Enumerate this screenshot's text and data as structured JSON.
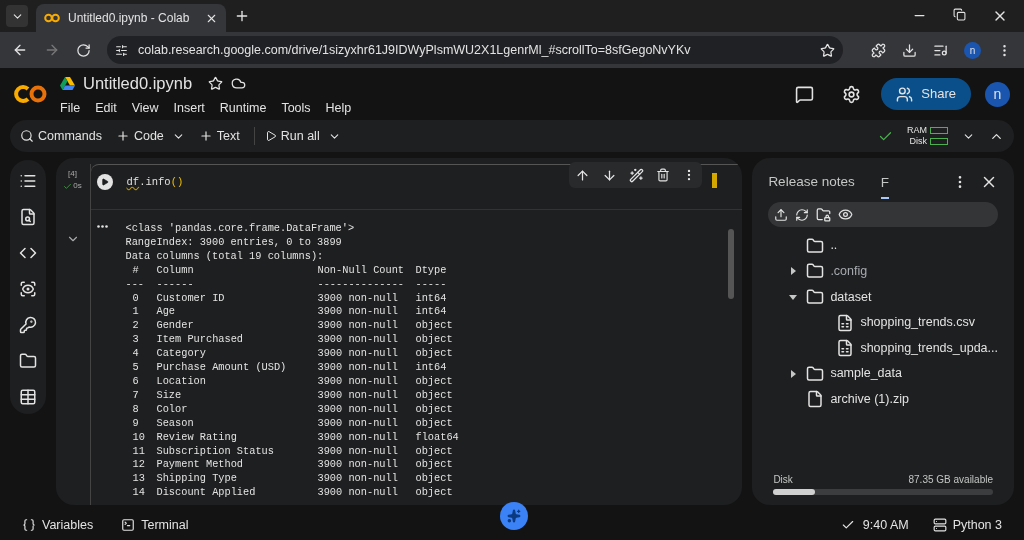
{
  "browser": {
    "tab_title": "Untitled0.ipynb - Colab",
    "url": "colab.research.google.com/drive/1sizyxhr61J9IDWyPlsmWU2X1LgenrMl_#scrollTo=8sfGegoNvYKv",
    "avatar": "n"
  },
  "app": {
    "title": "Untitled0.ipynb",
    "menu": [
      "File",
      "Edit",
      "View",
      "Insert",
      "Runtime",
      "Tools",
      "Help"
    ],
    "share": "Share",
    "avatar": "n"
  },
  "toolbar": {
    "commands": "Commands",
    "code": "Code",
    "text": "Text",
    "run_all": "Run all",
    "ram": "RAM",
    "disk": "Disk"
  },
  "cell": {
    "exec_count": "[4]",
    "time": "0s",
    "code": {
      "object": "df",
      "method": ".info",
      "parens": "()"
    }
  },
  "output": {
    "lines": [
      "<class 'pandas.core.frame.DataFrame'>",
      "RangeIndex: 3900 entries, 0 to 3899",
      "Data columns (total 19 columns):"
    ],
    "table": {
      "columns": [
        "#",
        "Column",
        "Non-Null Count",
        "Dtype"
      ],
      "rules": [
        "---",
        "------",
        "--------------",
        "-----"
      ],
      "rows": [
        [
          "0",
          "Customer ID",
          "3900 non-null",
          "int64"
        ],
        [
          "1",
          "Age",
          "3900 non-null",
          "int64"
        ],
        [
          "2",
          "Gender",
          "3900 non-null",
          "object"
        ],
        [
          "3",
          "Item Purchased",
          "3900 non-null",
          "object"
        ],
        [
          "4",
          "Category",
          "3900 non-null",
          "object"
        ],
        [
          "5",
          "Purchase Amount (USD)",
          "3900 non-null",
          "int64"
        ],
        [
          "6",
          "Location",
          "3900 non-null",
          "object"
        ],
        [
          "7",
          "Size",
          "3900 non-null",
          "object"
        ],
        [
          "8",
          "Color",
          "3900 non-null",
          "object"
        ],
        [
          "9",
          "Season",
          "3900 non-null",
          "object"
        ],
        [
          "10",
          "Review Rating",
          "3900 non-null",
          "float64"
        ],
        [
          "11",
          "Subscription Status",
          "3900 non-null",
          "object"
        ],
        [
          "12",
          "Payment Method",
          "3900 non-null",
          "object"
        ],
        [
          "13",
          "Shipping Type",
          "3900 non-null",
          "object"
        ],
        [
          "14",
          "Discount Applied",
          "3900 non-null",
          "object"
        ]
      ]
    }
  },
  "files_panel": {
    "title": "Release notes",
    "tab": "F",
    "tree": [
      {
        "name": "..",
        "kind": "folder"
      },
      {
        "name": ".config",
        "kind": "folder",
        "expanded": false
      },
      {
        "name": "dataset",
        "kind": "folder",
        "expanded": true,
        "children": [
          {
            "name": "shopping_trends.csv",
            "kind": "csv"
          },
          {
            "name": "shopping_trends_upda...",
            "kind": "csv"
          }
        ]
      },
      {
        "name": "sample_data",
        "kind": "folder",
        "expanded": false
      },
      {
        "name": "archive (1).zip",
        "kind": "file"
      }
    ],
    "disk": {
      "label": "Disk",
      "reading": "87.35 GB available",
      "level": 0.19
    }
  },
  "status": {
    "variables": "Variables",
    "terminal": "Terminal",
    "time": "9:40 AM",
    "runtime": "Python 3"
  }
}
